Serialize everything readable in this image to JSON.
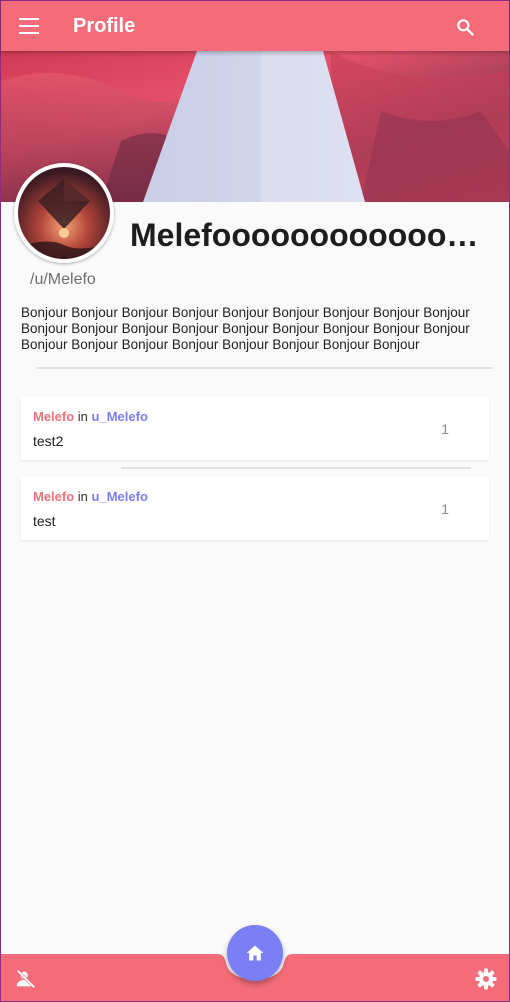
{
  "app_bar": {
    "title": "Profile",
    "menu_icon": "menu-icon",
    "search_icon": "search-icon",
    "color": "#f46c7a"
  },
  "profile": {
    "display_name": "Melefooooooooooooooooo",
    "handle": "/u/Melefo",
    "bio": "Bonjour Bonjour Bonjour Bonjour Bonjour Bonjour Bonjour Bonjour Bonjour Bonjour Bonjour Bonjour Bonjour Bonjour Bonjour Bonjour Bonjour Bonjour Bonjour Bonjour Bonjour Bonjour Bonjour Bonjour Bonjour Bonjour"
  },
  "posts": [
    {
      "author": "Melefo",
      "in_label": "in",
      "community": "u_Melefo",
      "title": "test2",
      "count": "1"
    },
    {
      "author": "Melefo",
      "in_label": "in",
      "community": "u_Melefo",
      "title": "test",
      "count": "1"
    }
  ],
  "bottom_bar": {
    "left_icon": "person-off-icon",
    "fab_icon": "home-icon",
    "right_icon": "settings-icon",
    "color": "#f46c7a",
    "fab_color": "#7a7ff6"
  },
  "colors": {
    "author": "#f4707c",
    "community": "#7b7ff5",
    "background": "#fafafa"
  }
}
